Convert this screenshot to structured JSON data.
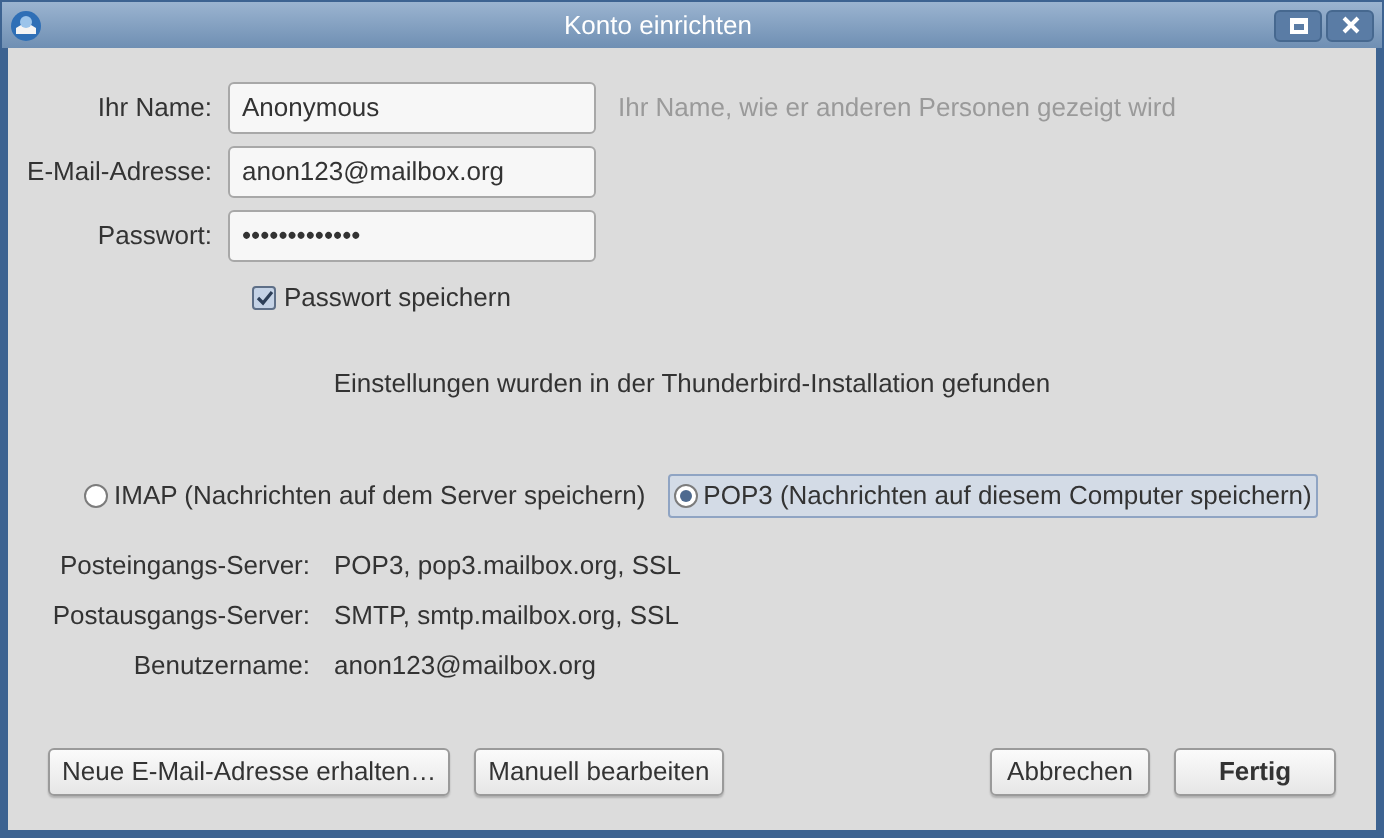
{
  "window": {
    "title": "Konto einrichten"
  },
  "fields": [
    {
      "label": "Ihr Name:",
      "value": "Anonymous",
      "hint": "Ihr Name, wie er anderen Personen gezeigt wird"
    },
    {
      "label": "E-Mail-Adresse:",
      "value": "anon123@mailbox.org"
    },
    {
      "label": "Passwort:",
      "value": "•••••••••••••"
    }
  ],
  "remember_password": {
    "label": "Passwort speichern",
    "checked": true
  },
  "status": "Einstellungen wurden in der Thunderbird-Installation gefunden",
  "protocols": [
    {
      "label": "IMAP (Nachrichten auf dem Server speichern)",
      "selected": false
    },
    {
      "label": "POP3 (Nachrichten auf diesem Computer speichern)",
      "selected": true
    }
  ],
  "server_info": [
    {
      "label": "Posteingangs-Server:",
      "value": "POP3, pop3.mailbox.org, SSL"
    },
    {
      "label": "Postausgangs-Server:",
      "value": "SMTP, smtp.mailbox.org, SSL"
    },
    {
      "label": "Benutzername:",
      "value": "anon123@mailbox.org"
    }
  ],
  "buttons_left": [
    {
      "label": "Neue E-Mail-Adresse erhalten…",
      "default": false
    },
    {
      "label": "Manuell bearbeiten",
      "default": false
    }
  ],
  "buttons_right": [
    {
      "label": "Abbrechen",
      "default": false
    },
    {
      "label": "Fertig",
      "default": true
    }
  ]
}
